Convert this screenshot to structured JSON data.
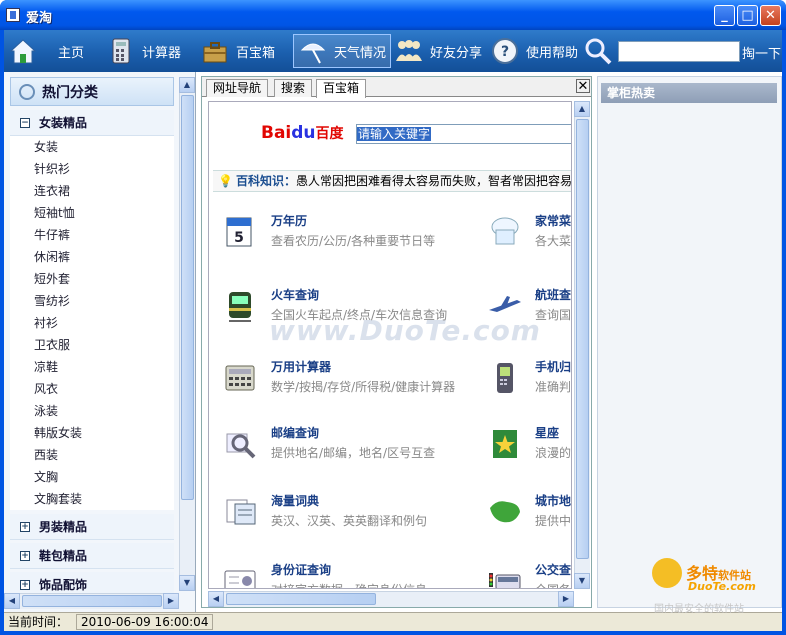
{
  "window": {
    "title": "爱淘",
    "controls": [
      "minimize",
      "maximize",
      "close"
    ]
  },
  "toolbar": {
    "items": [
      {
        "label": "主页",
        "icon": "home-icon"
      },
      {
        "label": "计算器",
        "icon": "calculator-icon"
      },
      {
        "label": "百宝箱",
        "icon": "toolbox-icon"
      },
      {
        "label": "天气情况",
        "icon": "weather-icon"
      },
      {
        "label": "好友分享",
        "icon": "friends-icon"
      },
      {
        "label": "使用帮助",
        "icon": "help-icon"
      }
    ],
    "search_value": "",
    "search_button": "掏一下"
  },
  "left": {
    "header": "热门分类",
    "expanded_group": "女装精品",
    "items": [
      "女装",
      "针织衫",
      "连衣裙",
      "短袖t恤",
      "牛仔裤",
      "休闲裤",
      "短外套",
      "雪纺衫",
      "衬衫",
      "卫衣服",
      "凉鞋",
      "风衣",
      "泳装",
      "韩版女装",
      "西装",
      "文胸",
      "文胸套装"
    ],
    "collapsed_groups": [
      "男装精品",
      "鞋包精品",
      "饰品配饰"
    ]
  },
  "tabs": [
    "网址导航",
    "搜索",
    "百宝箱"
  ],
  "active_tab": "百宝箱",
  "baidu": {
    "logo_bai": "Bai",
    "logo_du": "du",
    "logo_cn": "百度",
    "search_value": "请输入关键字"
  },
  "tip": {
    "label": "百科知识：",
    "text": "愚人常因把困难看得太容易而失败，智者常因把容易"
  },
  "tools_left": [
    {
      "name": "万年历",
      "desc": "查看农历/公历/各种重要节日等"
    },
    {
      "name": "火车查询",
      "desc": "全国火车起点/终点/车次信息查询"
    },
    {
      "name": "万用计算器",
      "desc": "数学/按揭/存贷/所得税/健康计算器"
    },
    {
      "name": "邮编查询",
      "desc": "提供地名/邮编，地名/区号互查"
    },
    {
      "name": "海量词典",
      "desc": "英汉、汉英、英英翻译和例句"
    },
    {
      "name": "身份证查询",
      "desc": "对接官方数据，确定身份信息"
    }
  ],
  "tools_right": [
    {
      "name": "家常菜",
      "desc": "各大菜"
    },
    {
      "name": "航班查",
      "desc": "查询国"
    },
    {
      "name": "手机归",
      "desc": "准确判"
    },
    {
      "name": "星座",
      "desc": "浪漫的"
    },
    {
      "name": "城市地",
      "desc": "提供中"
    },
    {
      "name": "公交查",
      "desc": "全国各"
    }
  ],
  "watermark": "www.DuoTe.com",
  "right_panel": {
    "header": "掌柜热卖"
  },
  "status": {
    "label": "当前时间：",
    "time": "2010-06-09 16:00:04"
  },
  "brand": {
    "line1": "多特",
    "line1b": "软件站",
    "line2": "DuoTe.com",
    "line3": "国内最安全的软件站"
  },
  "colors": {
    "titlebar": "#0055e5",
    "toolbar": "#1b5fae",
    "link": "#1a3f86",
    "baidu_red": "#e10602",
    "baidu_blue": "#2932e1"
  }
}
